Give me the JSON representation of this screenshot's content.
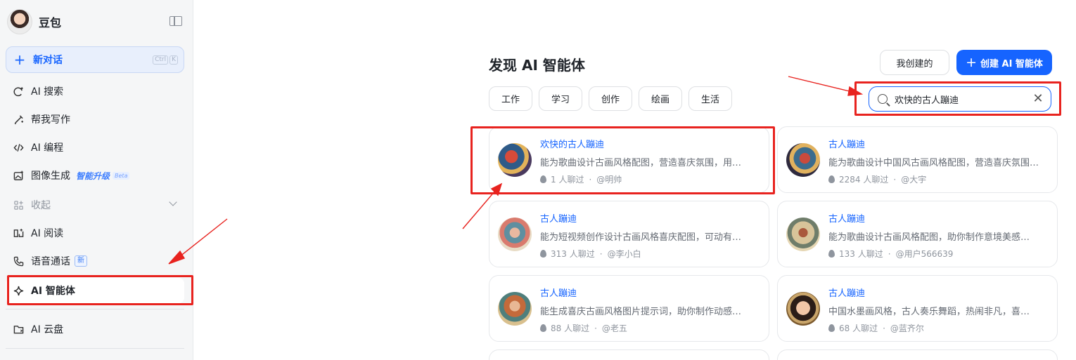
{
  "sidebar": {
    "app_name": "豆包",
    "new_chat": {
      "label": "新对话",
      "shortcut": [
        "Ctrl",
        "K"
      ]
    },
    "items": [
      {
        "label": "AI 搜索",
        "icon": "ai-search-icon"
      },
      {
        "label": "帮我写作",
        "icon": "pen-icon"
      },
      {
        "label": "AI 编程",
        "icon": "code-icon"
      },
      {
        "label": "图像生成",
        "icon": "image-icon",
        "badge": "智能升级",
        "badge2": "Beta"
      },
      {
        "label": "收起",
        "icon": "apps-icon"
      },
      {
        "label": "AI 阅读",
        "icon": "book-icon"
      },
      {
        "label": "语音通话",
        "icon": "phone-icon",
        "badge": "新"
      },
      {
        "label": "AI 智能体",
        "icon": "sparkle-icon"
      },
      {
        "label": "AI 云盘",
        "icon": "folder-icon"
      }
    ]
  },
  "main": {
    "title": "发现 AI 智能体",
    "my_created": "我创建的",
    "create_agent": "创建 AI 智能体",
    "categories": [
      "工作",
      "学习",
      "创作",
      "绘画",
      "生活"
    ],
    "search": {
      "value": "欢快的古人蹦迪"
    },
    "cards": [
      {
        "name": "欢快的古人蹦迪",
        "desc": "能为歌曲设计古画风格配图，营造喜庆氛围，用…",
        "chats": "1 人聊过",
        "author": "@明帅"
      },
      {
        "name": "古人蹦迪",
        "desc": "能为歌曲设计中国风古画风格配图，营造喜庆氛围，…",
        "chats": "2284 人聊过",
        "author": "@大宇"
      },
      {
        "name": "古人蹦迪",
        "desc": "能为短视频创作设计古画风格喜庆配图，可动有…",
        "chats": "313 人聊过",
        "author": "@李小白"
      },
      {
        "name": "古人蹦迪",
        "desc": "能为歌曲设计古画风格配图，助你制作意境美感…",
        "chats": "133 人聊过",
        "author": "@用户566639"
      },
      {
        "name": "古人蹦迪",
        "desc": "能生成喜庆古画风格图片提示词，助你制作动感…",
        "chats": "88 人聊过",
        "author": "@老五"
      },
      {
        "name": "古人蹦迪",
        "desc": "中国水墨画风格，古人奏乐舞蹈，热闹非凡，喜…",
        "chats": "68 人聊过",
        "author": "@蓝齐尔"
      }
    ]
  },
  "colors": {
    "accent": "#1664ff",
    "annotation": "#e8231f"
  }
}
